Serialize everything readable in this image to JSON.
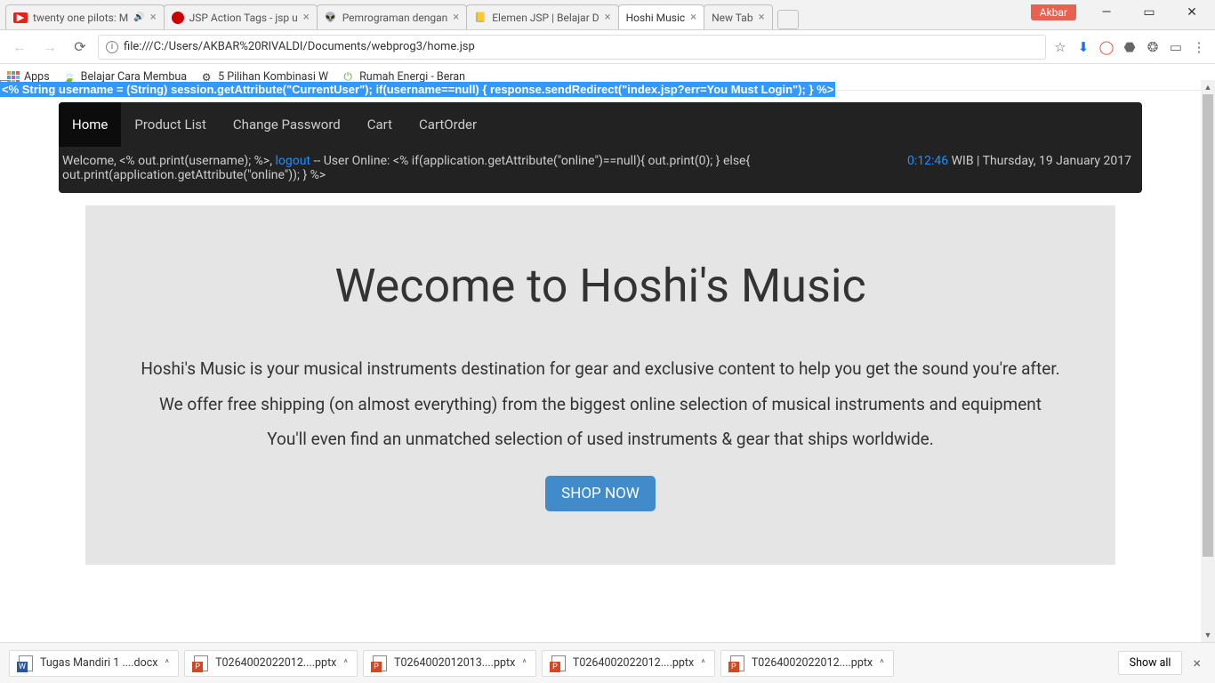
{
  "window_user": "Akbar",
  "tabs": [
    {
      "label": "twenty one pilots: M",
      "has_sound": true
    },
    {
      "label": "JSP Action Tags - jsp u"
    },
    {
      "label": "Pemrograman dengan"
    },
    {
      "label": "Elemen JSP | Belajar D"
    },
    {
      "label": "Hoshi Music",
      "active": true
    },
    {
      "label": "New Tab"
    }
  ],
  "url": "file:///C:/Users/AKBAR%20RIVALDI/Documents/webprog3/home.jsp",
  "bookmarks": {
    "apps": "Apps",
    "items": [
      "Belajar Cara Membua",
      "5 Pilihan Kombinasi W",
      "Rumah Energi - Beran"
    ]
  },
  "jsp_leak": "<% String username = (String) session.getAttribute(\"CurrentUser\"); if(username==null) { response.sendRedirect(\"index.jsp?err=You Must Login\"); } %>",
  "nav": [
    "Home",
    "Product List",
    "Change Password",
    "Cart",
    "CartOrder"
  ],
  "subbar": {
    "welcome_prefix": "Welcome, <% out.print(username); %>, ",
    "logout": "logout",
    "online_text": " -- User Online: <% if(application.getAttribute(\"online\")==null){ out.print(0); } else{ out.print(application.getAttribute(\"online\")); } %>",
    "time": "0:12:46",
    "tz_date": " WIB | Thursday, 19 January 2017"
  },
  "hero": {
    "title": "Wecome to Hoshi's Music",
    "p1": "Hoshi's Music is your musical instruments destination for gear and exclusive content to help you get the sound you're after.",
    "p2": "We offer free shipping (on almost everything) from the biggest online selection of musical instruments and equipment",
    "p3": "You'll even find an unmatched selection of used instruments & gear that ships worldwide.",
    "button": "SHOP NOW"
  },
  "downloads": [
    {
      "name": "Tugas Mandiri 1 ....docx",
      "type": "word"
    },
    {
      "name": "T0264002022012....pptx",
      "type": "ppt"
    },
    {
      "name": "T0264002012013....pptx",
      "type": "ppt"
    },
    {
      "name": "T0264002022012....pptx",
      "type": "ppt"
    },
    {
      "name": "T0264002022012....pptx",
      "type": "ppt"
    }
  ],
  "show_all": "Show all"
}
